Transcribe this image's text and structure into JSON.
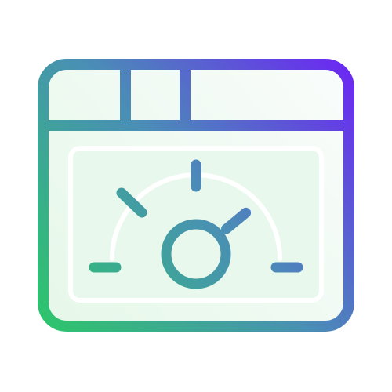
{
  "icon": {
    "name": "browser-window-dashboard-gauge-icon",
    "description_label": "",
    "gauge_level": 0.78,
    "colors": {
      "gradient_start": "#2EC36E",
      "gradient_mid": "#4A8FB5",
      "gradient_end": "#6A2BF0",
      "fill_start": "#E6F8E9",
      "fill_end": "#F9FCFB"
    }
  }
}
